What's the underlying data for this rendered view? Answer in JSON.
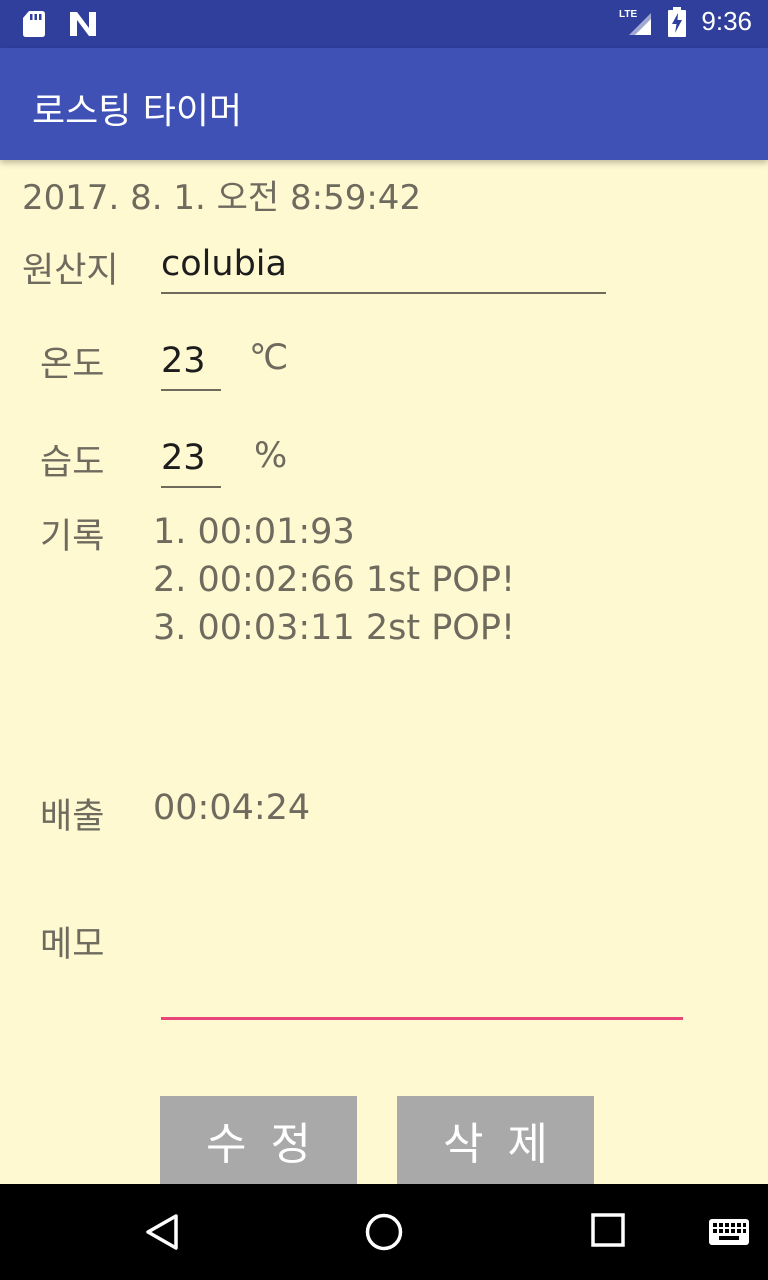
{
  "status_bar": {
    "time": "9:36",
    "icons": [
      "sd-card-icon",
      "n-logo-icon",
      "lte-signal-icon",
      "battery-charging-icon"
    ]
  },
  "app_bar": {
    "title": "로스팅 타이머"
  },
  "main": {
    "datetime": "2017. 8. 1. 오전 8:59:42",
    "origin": {
      "label": "원산지",
      "value": "colubia"
    },
    "temperature": {
      "label": "온도",
      "value": "23",
      "unit": "℃"
    },
    "humidity": {
      "label": "습도",
      "value": "23",
      "unit": "%"
    },
    "records": {
      "label": "기록",
      "items": [
        "1. 00:01:93",
        "2. 00:02:66 1st POP!",
        "3. 00:03:11 2st POP!"
      ]
    },
    "release": {
      "label": "배출",
      "value": "00:04:24"
    },
    "memo": {
      "label": "메모",
      "value": ""
    }
  },
  "buttons": {
    "edit": "수정",
    "delete": "삭제"
  },
  "nav_bar": {
    "icons": [
      "back-icon",
      "home-icon",
      "recents-icon",
      "keyboard-icon"
    ]
  },
  "colors": {
    "status_bar": "#2f3f9b",
    "app_bar": "#3f51b5",
    "background": "#fff9d2",
    "accent": "#e8457a",
    "button": "#a9a9a9"
  }
}
